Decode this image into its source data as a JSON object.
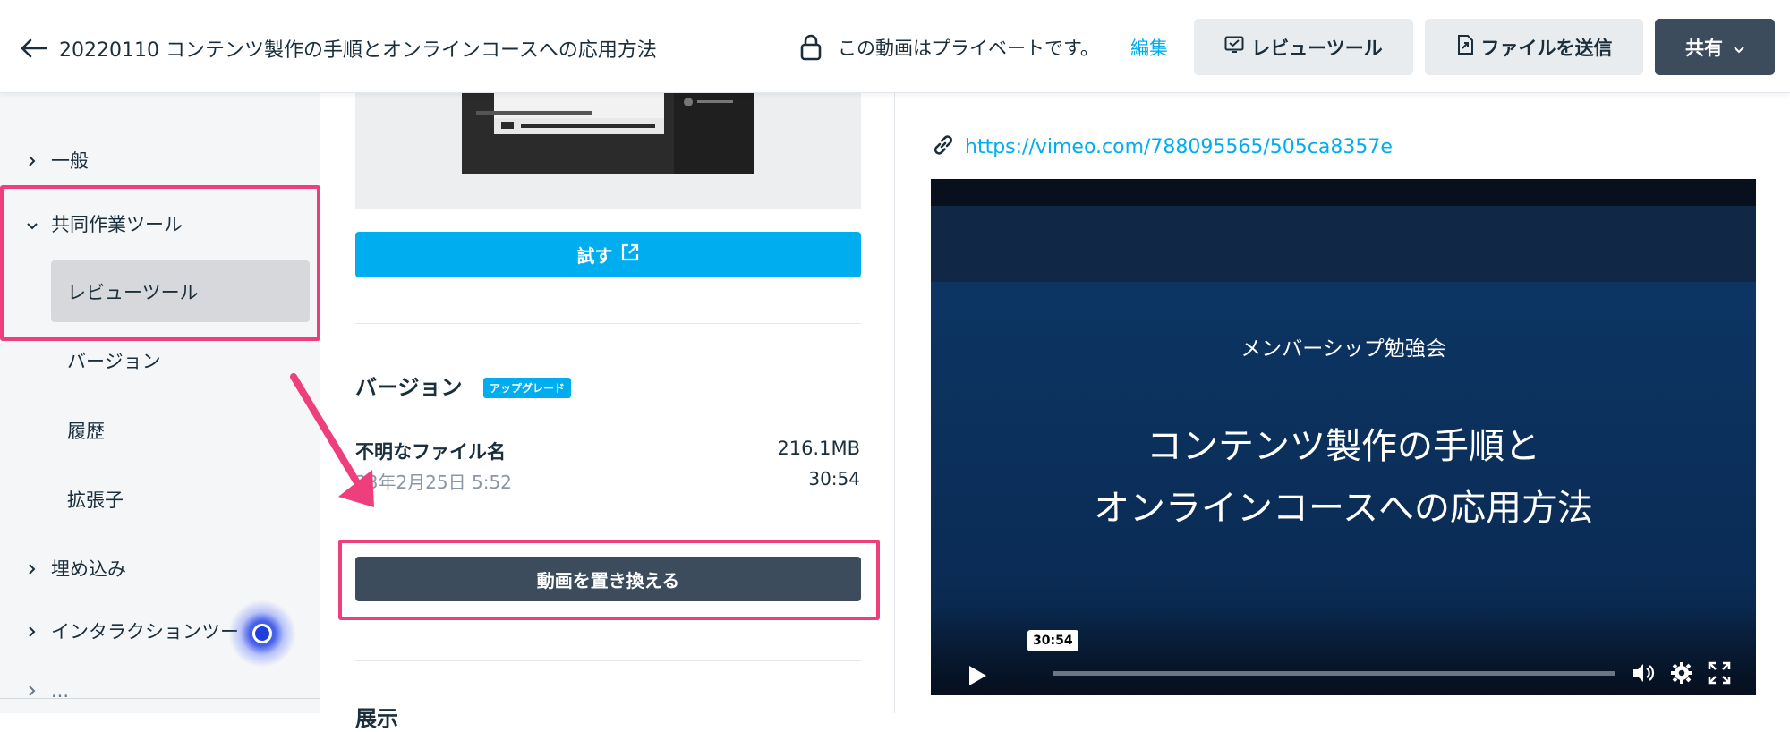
{
  "header": {
    "title": "20220110 コンテンツ製作の手順とオンラインコースへの応用方法",
    "privacy_text": "この動画はプライベートです。",
    "edit_label": "編集",
    "review_tool_label": "レビューツール",
    "send_file_label": "ファイルを送信",
    "share_label": "共有"
  },
  "sidebar": {
    "general": "一般",
    "collab_tools": "共同作業ツール",
    "review_tool": "レビューツール",
    "version": "バージョン",
    "history": "履歴",
    "extensions": "拡張子",
    "embed": "埋め込み",
    "interaction_tools": "インタラクションツー",
    "cut_off_item": "..."
  },
  "middle": {
    "try_label": "試す",
    "version_title": "バージョン",
    "upgrade_badge": "アップグレード",
    "file_name": "不明なファイル名",
    "file_size": "216.1MB",
    "file_date": "23年2月25日 5:52",
    "file_duration": "30:54",
    "replace_label": "動画を置き換える",
    "next_section": "展示"
  },
  "player": {
    "url": "https://vimeo.com/788095565/505ca8357e",
    "subtitle": "メンバーシップ勉強会",
    "line1": "コンテンツ製作の手順と",
    "line2": "オンラインコースへの応用方法",
    "time": "30:54"
  },
  "colors": {
    "accent": "#00adef",
    "highlight": "#ee3e7c",
    "dark_button": "#3c4c5c"
  }
}
